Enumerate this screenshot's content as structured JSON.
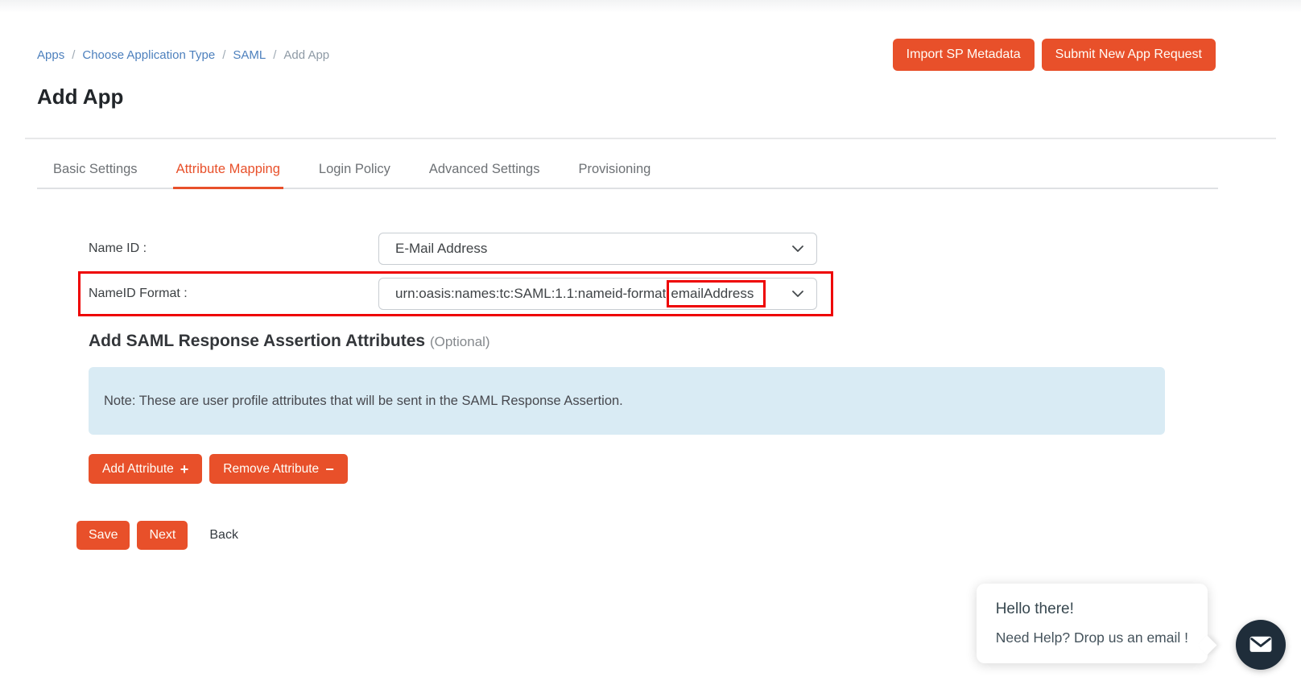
{
  "page": {
    "title": "Add App"
  },
  "breadcrumb": {
    "separator": "/",
    "items": [
      {
        "label": "Apps",
        "type": "link"
      },
      {
        "label": "Choose Application Type",
        "type": "link"
      },
      {
        "label": "SAML",
        "type": "link"
      },
      {
        "label": "Add App",
        "type": "current"
      }
    ]
  },
  "header_buttons": {
    "import_sp_metadata": "Import SP Metadata",
    "submit_new_app_request": "Submit New App Request"
  },
  "tabs": {
    "active": "Attribute Mapping",
    "items": [
      {
        "label": "Basic Settings"
      },
      {
        "label": "Attribute Mapping"
      },
      {
        "label": "Login Policy"
      },
      {
        "label": "Advanced Settings"
      },
      {
        "label": "Provisioning"
      }
    ]
  },
  "form": {
    "name_id": {
      "label": "Name ID :",
      "value": "E-Mail Address"
    },
    "nameid_format": {
      "label": "NameID Format :",
      "value": "urn:oasis:names:tc:SAML:1.1:nameid-format:emailAddress",
      "value_prefix": "urn:oasis:names:tc:SAML:1.1:nameid-format",
      "value_highlighted": "emailAddress"
    }
  },
  "assertion_section": {
    "title": "Add SAML Response Assertion Attributes",
    "optional_tag": "(Optional)",
    "note": "Note: These are user profile attributes that will be sent in the SAML Response Assertion.",
    "add_button": "Add Attribute",
    "add_icon": "+",
    "remove_button": "Remove Attribute",
    "remove_icon": "−"
  },
  "actions": {
    "save": "Save",
    "next": "Next",
    "back": "Back"
  },
  "chat_widget": {
    "greeting": "Hello there!",
    "message": "Need Help? Drop us an email !",
    "launcher_icon": "envelope-icon"
  },
  "icons": {
    "select_chevron": "chevron-down-icon",
    "add": "plus-icon",
    "remove": "minus-icon",
    "chat": "envelope-icon"
  },
  "colors": {
    "accent_orange": "#e8502a",
    "highlight_red": "#ee0202",
    "note_background": "#d9ebf4",
    "link_blue": "#4d80bd",
    "chat_launcher_navy": "#1f2d3a"
  }
}
